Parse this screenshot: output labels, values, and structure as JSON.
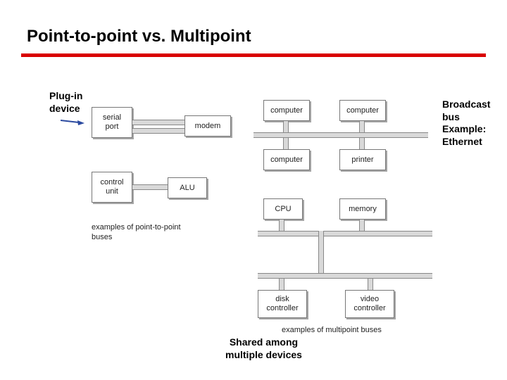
{
  "title": "Point-to-point vs. Multipoint",
  "annotations": {
    "plug_in": "Plug-in\ndevice",
    "broadcast": "Broadcast\nbus\nExample:\nEthernet",
    "shared": "Shared among\nmultiple devices"
  },
  "boxes": {
    "serial_port": "serial\nport",
    "modem": "modem",
    "control_unit": "control\nunit",
    "alu": "ALU",
    "computer_tl": "computer",
    "computer_tr": "computer",
    "computer_bl": "computer",
    "printer_br": "printer",
    "cpu": "CPU",
    "memory": "memory",
    "disk_controller": "disk\ncontroller",
    "video_controller": "video\ncontroller"
  },
  "captions": {
    "ptp": "examples of point-to-point\nbuses",
    "multi": "examples of multipoint buses"
  }
}
